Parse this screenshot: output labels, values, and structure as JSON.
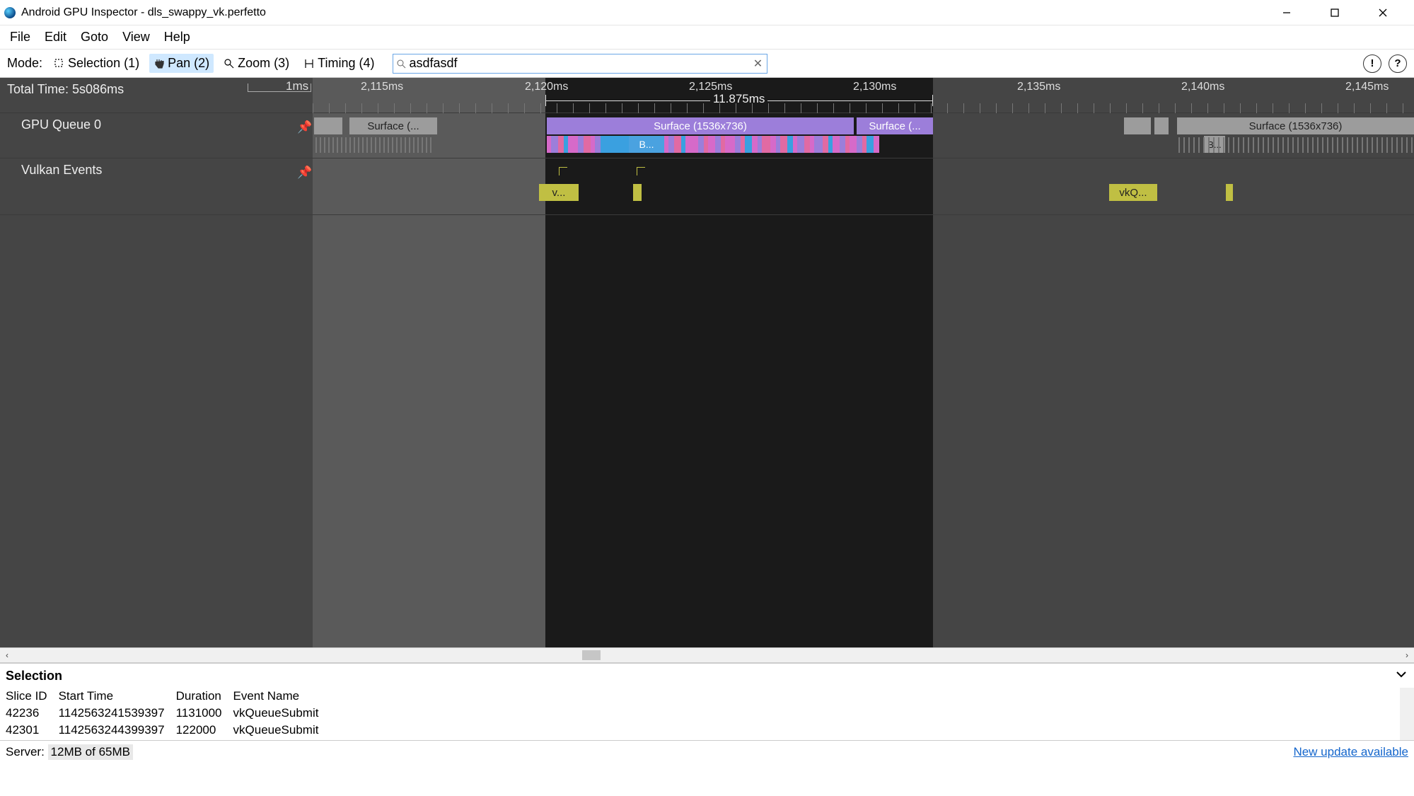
{
  "window": {
    "title": "Android GPU Inspector - dls_swappy_vk.perfetto"
  },
  "menu": [
    "File",
    "Edit",
    "Goto",
    "View",
    "Help"
  ],
  "toolbar": {
    "mode_label": "Mode:",
    "modes": [
      {
        "label": "Selection (1)",
        "active": false
      },
      {
        "label": "Pan (2)",
        "active": true
      },
      {
        "label": "Zoom (3)",
        "active": false
      },
      {
        "label": "Timing (4)",
        "active": false
      }
    ],
    "search_value": "asdfasdf"
  },
  "timeline": {
    "total_time_label": "Total Time: 5s086ms",
    "scale_label": "1ms",
    "tick_labels": [
      "2,115ms",
      "2,120ms",
      "2,125ms",
      "2,130ms",
      "2,135ms",
      "2,140ms",
      "2,145ms"
    ],
    "viewport_label": "11.875ms",
    "tracks": [
      {
        "name": "GPU Queue 0",
        "slices": [
          {
            "label": "Surface (...",
            "type": "gray"
          },
          {
            "label": "Surface (1536x736)",
            "type": "purple",
            "sub_label": "B..."
          },
          {
            "label": "Surface (...",
            "type": "purple"
          },
          {
            "label": "Surface (1536x736)",
            "type": "gray",
            "sub_label": "B..."
          }
        ]
      },
      {
        "name": "Vulkan Events",
        "slices": [
          {
            "label": "v...",
            "type": "olive"
          },
          {
            "label": "vkQ...",
            "type": "olive"
          }
        ]
      }
    ]
  },
  "selection": {
    "title": "Selection",
    "columns": [
      "Slice ID",
      "Start Time",
      "Duration",
      "Event Name"
    ],
    "rows": [
      [
        "42236",
        "1142563241539397",
        "1131000",
        "vkQueueSubmit"
      ],
      [
        "42301",
        "1142563244399397",
        "122000",
        "vkQueueSubmit"
      ]
    ]
  },
  "status": {
    "server_label": "Server:",
    "mem": "12MB of 65MB",
    "update_link": "New update available"
  }
}
